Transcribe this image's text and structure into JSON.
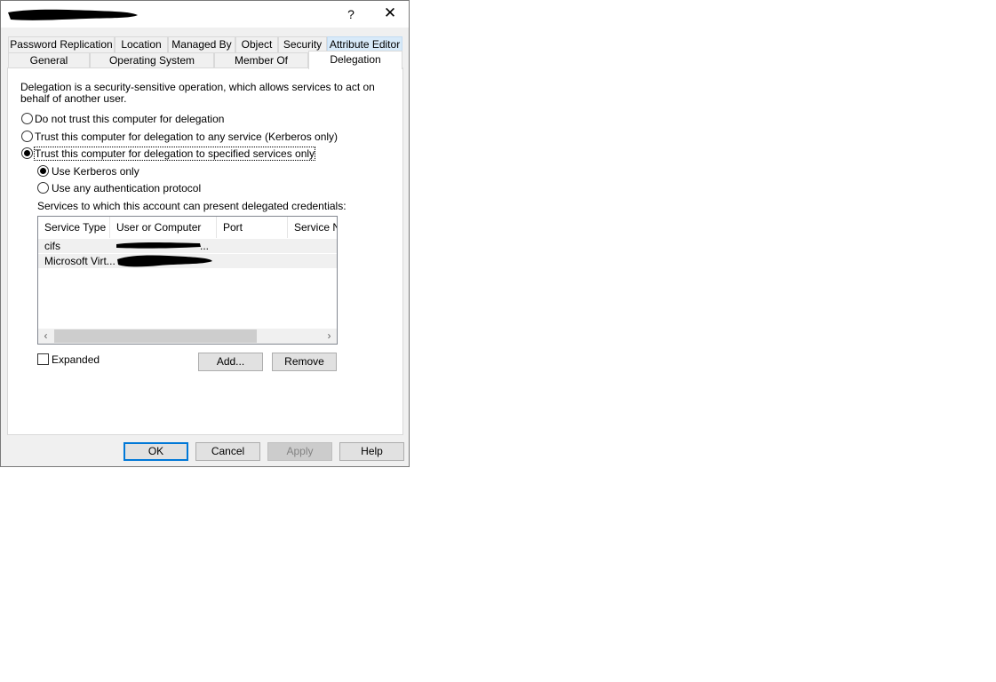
{
  "window": {
    "help_glyph": "?",
    "close_glyph": "✕"
  },
  "tabs_top": [
    {
      "label": "Password Replication"
    },
    {
      "label": "Location"
    },
    {
      "label": "Managed By"
    },
    {
      "label": "Object"
    },
    {
      "label": "Security"
    },
    {
      "label": "Attribute Editor"
    }
  ],
  "tabs_bottom": [
    {
      "label": "General"
    },
    {
      "label": "Operating System"
    },
    {
      "label": "Member Of"
    },
    {
      "label": "Delegation"
    }
  ],
  "delegation": {
    "description_line1": "Delegation is a security-sensitive operation, which allows services to act on",
    "description_line2": "behalf of another user.",
    "opt_no_trust": "Do not trust this computer for delegation",
    "opt_any_service": "Trust this computer for delegation to any service (Kerberos only)",
    "opt_specified": "Trust this computer for delegation to specified services only",
    "selected_option": "specified",
    "sub_kerberos": "Use Kerberos only",
    "sub_any_protocol": "Use any authentication protocol",
    "selected_sub": "kerberos",
    "services_label": "Services to which this account can present delegated credentials:",
    "columns": [
      "Service Type",
      "User or Computer",
      "Port",
      "Service Na"
    ],
    "rows": [
      {
        "service_type": "cifs",
        "user_or_computer": "...",
        "port": "",
        "service_name": ""
      },
      {
        "service_type": "Microsoft Virt...",
        "user_or_computer": "",
        "port": "",
        "service_name": ""
      }
    ],
    "expanded_label": "Expanded",
    "expanded_checked": false,
    "add_label": "Add...",
    "remove_label": "Remove"
  },
  "footer": {
    "ok_label": "OK",
    "cancel_label": "Cancel",
    "apply_label": "Apply",
    "help_label": "Help"
  },
  "colors": {
    "dialog_bg": "#f0f0f0",
    "tab_highlight": "#d8eaf9",
    "default_button_border": "#0078d7",
    "redaction": "#000000"
  }
}
